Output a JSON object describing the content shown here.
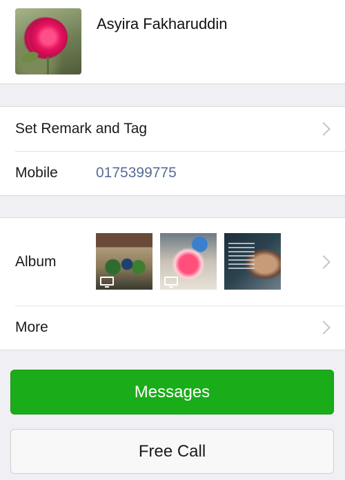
{
  "profile": {
    "name": "Asyira Fakharuddin"
  },
  "rows": {
    "remark": {
      "label": "Set Remark and Tag"
    },
    "mobile": {
      "label": "Mobile",
      "value": "0175399775"
    },
    "album": {
      "label": "Album"
    },
    "more": {
      "label": "More"
    }
  },
  "album_thumbs": [
    {
      "has_video": true
    },
    {
      "has_video": true
    },
    {
      "has_video": false
    }
  ],
  "buttons": {
    "messages": "Messages",
    "free_call": "Free Call"
  },
  "colors": {
    "accent_green": "#1aad19",
    "link_blue": "#576b95",
    "background": "#efeff4"
  }
}
